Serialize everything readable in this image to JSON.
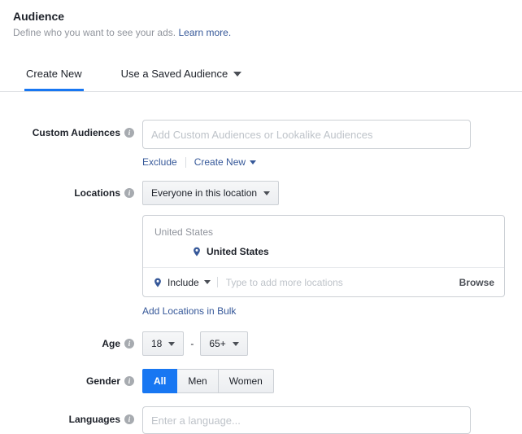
{
  "header": {
    "title": "Audience",
    "subtitle": "Define who you want to see your ads.",
    "learn_more": "Learn more."
  },
  "tabs": {
    "create_new": "Create New",
    "saved": "Use a Saved Audience"
  },
  "custom_audiences": {
    "label": "Custom Audiences",
    "placeholder": "Add Custom Audiences or Lookalike Audiences",
    "exclude_link": "Exclude",
    "create_new_link": "Create New"
  },
  "locations": {
    "label": "Locations",
    "scope_dropdown": "Everyone in this location",
    "group_header": "United States",
    "selected_location": "United States",
    "include_dropdown": "Include",
    "add_placeholder": "Type to add more locations",
    "browse_button": "Browse",
    "bulk_link": "Add Locations in Bulk"
  },
  "age": {
    "label": "Age",
    "min": "18",
    "max": "65+",
    "separator": "-"
  },
  "gender": {
    "label": "Gender",
    "options": [
      "All",
      "Men",
      "Women"
    ],
    "selected": "All"
  },
  "languages": {
    "label": "Languages",
    "placeholder": "Enter a language..."
  },
  "colors": {
    "accent": "#1877f2",
    "link": "#365899",
    "pin": "#365899"
  }
}
